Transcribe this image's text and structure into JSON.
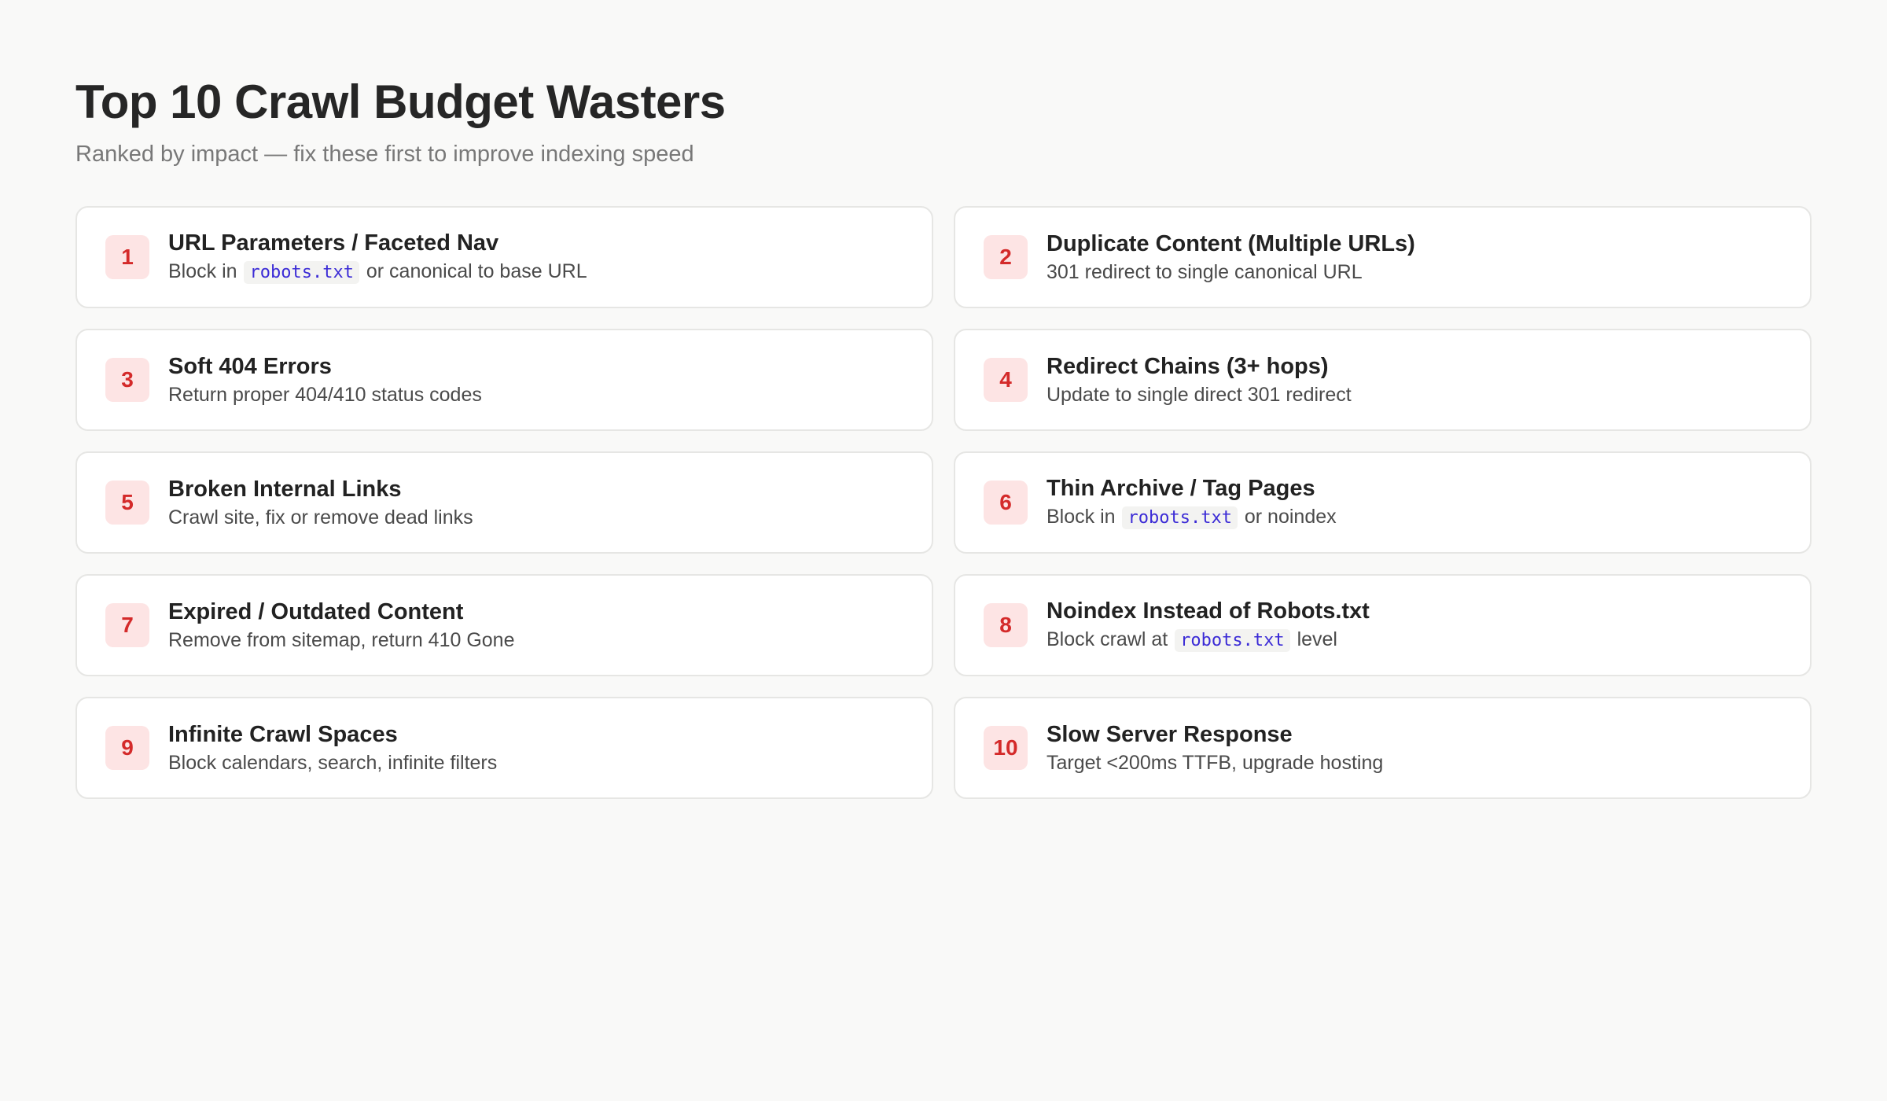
{
  "header": {
    "title": "Top 10 Crawl Budget Wasters",
    "subtitle": "Ranked by impact — fix these first to improve indexing speed"
  },
  "items": [
    {
      "rank": "1",
      "title": "URL Parameters / Faceted Nav",
      "desc_before": "Block in ",
      "code": "robots.txt",
      "desc_after": " or canonical to base URL"
    },
    {
      "rank": "2",
      "title": "Duplicate Content (Multiple URLs)",
      "desc_before": "301 redirect to single canonical URL",
      "code": "",
      "desc_after": ""
    },
    {
      "rank": "3",
      "title": "Soft 404 Errors",
      "desc_before": "Return proper 404/410 status codes",
      "code": "",
      "desc_after": ""
    },
    {
      "rank": "4",
      "title": "Redirect Chains (3+ hops)",
      "desc_before": "Update to single direct 301 redirect",
      "code": "",
      "desc_after": ""
    },
    {
      "rank": "5",
      "title": "Broken Internal Links",
      "desc_before": "Crawl site, fix or remove dead links",
      "code": "",
      "desc_after": ""
    },
    {
      "rank": "6",
      "title": "Thin Archive / Tag Pages",
      "desc_before": "Block in ",
      "code": "robots.txt",
      "desc_after": " or noindex"
    },
    {
      "rank": "7",
      "title": "Expired / Outdated Content",
      "desc_before": "Remove from sitemap, return 410 Gone",
      "code": "",
      "desc_after": ""
    },
    {
      "rank": "8",
      "title": "Noindex Instead of Robots.txt",
      "desc_before": "Block crawl at ",
      "code": "robots.txt",
      "desc_after": " level"
    },
    {
      "rank": "9",
      "title": "Infinite Crawl Spaces",
      "desc_before": "Block calendars, search, infinite filters",
      "code": "",
      "desc_after": ""
    },
    {
      "rank": "10",
      "title": "Slow Server Response",
      "desc_before": "Target <200ms TTFB, upgrade hosting",
      "code": "",
      "desc_after": ""
    }
  ]
}
